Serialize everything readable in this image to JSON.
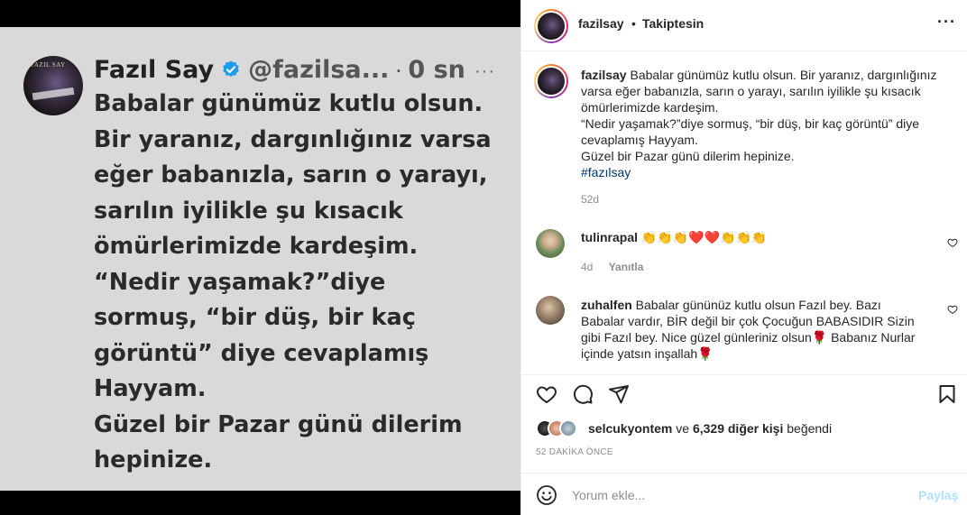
{
  "tweet": {
    "avatar_caption": "FAZIL SAY",
    "name": "Fazıl Say",
    "handle": "@fazilsa...",
    "sep": "·",
    "time": "0 sn",
    "more": "···",
    "lines": [
      "Babalar günümüz kutlu olsun.",
      "Bir yaranız, dargınlığınız varsa",
      "eğer babanızla, sarın o yarayı,",
      "sarılın iyilikle şu kısacık",
      "ömürlerimizde kardeşim.",
      "“Nedir yaşamak?”diye",
      "sormuş, “bir düş, bir kaç",
      "görüntü” diye cevaplamış",
      "Hayyam.",
      "Güzel bir Pazar günü dilerim",
      "hepinize."
    ]
  },
  "post": {
    "username": "fazilsay",
    "dot": "•",
    "follow_status": "Takiptesin",
    "more": "···",
    "caption": {
      "username": "fazilsay",
      "lines": [
        "Babalar günümüz kutlu olsun. Bir yaranız, dargınlığınız",
        "varsa eğer babanızla, sarın o yarayı, sarılın iyilikle şu kısacık",
        "ömürlerimizde kardeşim.",
        "“Nedir yaşamak?”diye sormuş, “bir düş, bir kaç görüntü” diye",
        "cevaplamış Hayyam.",
        "Güzel bir Pazar günü dilerim hepinize."
      ],
      "hashtag": "#fazılsay",
      "time": "52d"
    },
    "comments": [
      {
        "username": "tulinrapal",
        "text": "👏👏👏❤️❤️👏👏👏",
        "time": "4d",
        "reply": "Yanıtla"
      },
      {
        "username": "zuhalfen",
        "lines": [
          "Babalar gününüz kutlu olsun Fazıl bey. Bazı",
          "Babalar vardır, BİR değil bir çok Çocuğun BABASIDIR Sizin",
          "gibi Fazıl bey. Nice güzel günleriniz olsun🌹 Babanız Nurlar",
          "içinde yatsın inşallah🌹"
        ]
      }
    ],
    "likes": {
      "user": "selcukyontem",
      "and": "ve",
      "count_text": "6,329 diğer kişi",
      "suffix": "beğendi"
    },
    "posted_ago": "52 DAKİKA ÖNCE",
    "add_comment": {
      "placeholder": "Yorum ekle...",
      "post_label": "Paylaş"
    }
  },
  "colors": {
    "link": "#00376b",
    "muted": "#8e8e8e",
    "post_button_disabled": "#b2dffc",
    "tweet_bg": "#d9d9d9",
    "verified": "#1d9bf0"
  },
  "icons": [
    "verified-badge-icon",
    "more-icon",
    "heart-icon",
    "comment-icon",
    "share-icon",
    "bookmark-icon",
    "emoji-icon"
  ]
}
